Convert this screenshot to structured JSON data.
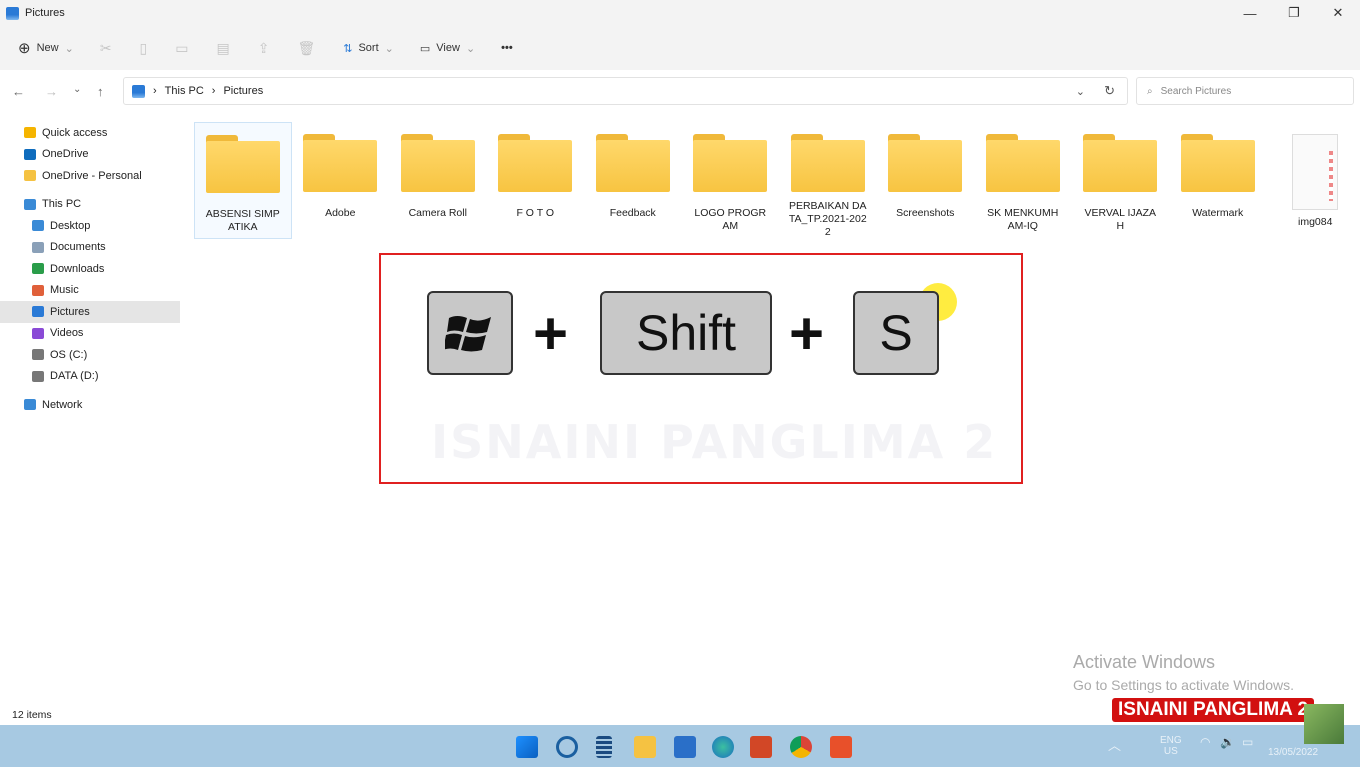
{
  "window": {
    "title": "Pictures",
    "minimize": "—",
    "maximize": "❐",
    "close": "✕"
  },
  "toolbar": {
    "new": "New",
    "sort": "Sort",
    "view": "View",
    "more": "•••"
  },
  "address": {
    "crumbs": [
      "This PC",
      "Pictures"
    ],
    "search_placeholder": "Search Pictures"
  },
  "sidebar": {
    "items": [
      {
        "label": "Quick access",
        "icon": "star-icon",
        "color": "#f5b400"
      },
      {
        "label": "OneDrive",
        "icon": "cloud-icon",
        "color": "#0f6cbd"
      },
      {
        "label": "OneDrive - Personal",
        "icon": "folder-icon",
        "color": "#f5c242"
      },
      {
        "label": "This PC",
        "icon": "computer-icon",
        "color": "#3a8ad6"
      },
      {
        "label": "Desktop",
        "icon": "desktop-icon",
        "color": "#3a8ad6"
      },
      {
        "label": "Documents",
        "icon": "document-icon",
        "color": "#8aa0b8"
      },
      {
        "label": "Downloads",
        "icon": "download-icon",
        "color": "#2a9d4a"
      },
      {
        "label": "Music",
        "icon": "music-icon",
        "color": "#e0603a"
      },
      {
        "label": "Pictures",
        "icon": "pictures-icon",
        "color": "#2a7ad6",
        "selected": true
      },
      {
        "label": "Videos",
        "icon": "video-icon",
        "color": "#8a4ad6"
      },
      {
        "label": "OS (C:)",
        "icon": "drive-icon",
        "color": "#777"
      },
      {
        "label": "DATA (D:)",
        "icon": "drive-icon",
        "color": "#777"
      },
      {
        "label": "Network",
        "icon": "network-icon",
        "color": "#3a8ad6"
      }
    ]
  },
  "files": [
    {
      "name": "ABSENSI SIMPATIKA",
      "type": "folder",
      "selected": true
    },
    {
      "name": "Adobe",
      "type": "folder"
    },
    {
      "name": "Camera Roll",
      "type": "folder"
    },
    {
      "name": "F O T O",
      "type": "folder"
    },
    {
      "name": "Feedback",
      "type": "folder"
    },
    {
      "name": "LOGO PROGRAM",
      "type": "folder"
    },
    {
      "name": "PERBAIKAN DATA_TP.2021-2022",
      "type": "folder"
    },
    {
      "name": "Screenshots",
      "type": "folder"
    },
    {
      "name": "SK MENKUMHAM-IQ",
      "type": "folder"
    },
    {
      "name": "VERVAL IJAZAH",
      "type": "folder"
    },
    {
      "name": "Watermark",
      "type": "folder"
    },
    {
      "name": "img084",
      "type": "image"
    }
  ],
  "overlay": {
    "keys": [
      "Shift",
      "S"
    ],
    "plus": "+",
    "watermark": "ISNAINI PANGLIMA 2",
    "border_color": "#e02020"
  },
  "status": {
    "items": "12 items"
  },
  "activation": {
    "title": "Activate Windows",
    "subtitle": "Go to Settings to activate Windows."
  },
  "brand": "ISNAINI PANGLIMA 2",
  "taskbar": {
    "lang1": "ENG",
    "lang2": "US",
    "date": "13/05/2022"
  }
}
